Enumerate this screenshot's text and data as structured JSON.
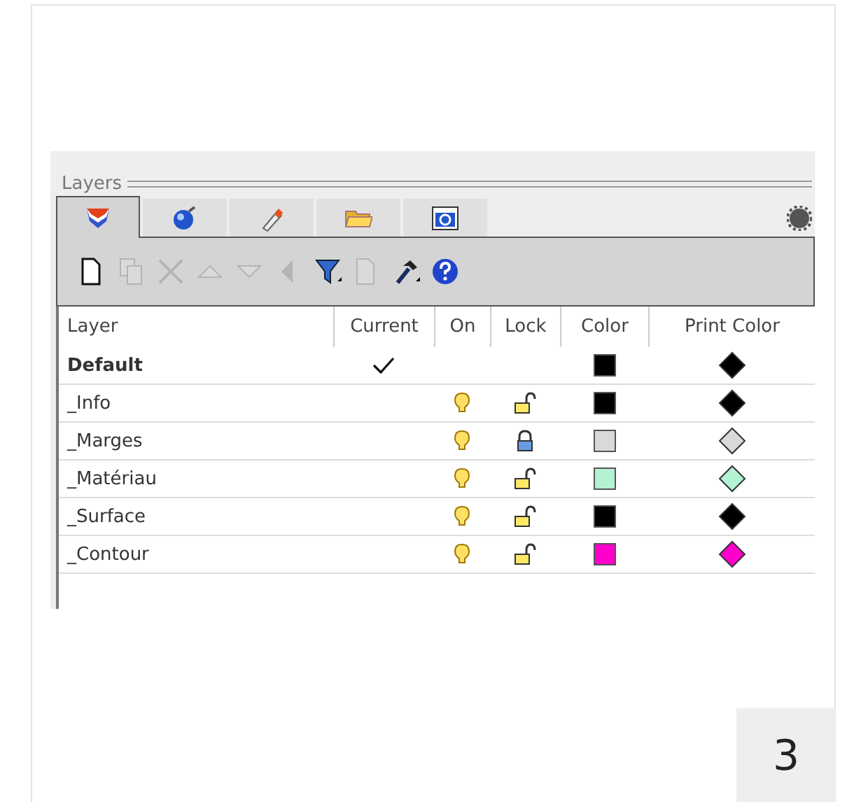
{
  "panel": {
    "title": "Layers"
  },
  "tabs": [
    {
      "kind": "layers",
      "selected": true
    },
    {
      "kind": "sphere",
      "selected": false
    },
    {
      "kind": "brush",
      "selected": false
    },
    {
      "kind": "folder",
      "selected": false
    },
    {
      "kind": "help",
      "selected": false
    }
  ],
  "toolbar": [
    {
      "kind": "new",
      "disabled": false
    },
    {
      "kind": "copy",
      "disabled": true
    },
    {
      "kind": "delete",
      "disabled": true
    },
    {
      "kind": "up",
      "disabled": true
    },
    {
      "kind": "down",
      "disabled": true
    },
    {
      "kind": "left",
      "disabled": true
    },
    {
      "kind": "filter",
      "disabled": false
    },
    {
      "kind": "page",
      "disabled": true
    },
    {
      "kind": "tools",
      "disabled": false
    },
    {
      "kind": "help",
      "disabled": false
    }
  ],
  "table": {
    "columns": [
      "Layer",
      "Current",
      "On",
      "Lock",
      "Color",
      "Print Color"
    ],
    "rows": [
      {
        "name": "Default",
        "current": true,
        "color": "#000000",
        "print": {
          "color": "#000000"
        }
      },
      {
        "name": "_Info",
        "current": false,
        "on": true,
        "locked": false,
        "color": "#000000",
        "print": {
          "color": "#000000"
        }
      },
      {
        "name": "_Marges",
        "current": false,
        "on": true,
        "locked": true,
        "color": "#d9d9d9",
        "print": {
          "color": "#d9d9d9"
        }
      },
      {
        "name": "_Matériau",
        "current": false,
        "on": true,
        "locked": false,
        "color": "#b3f2d2",
        "print": {
          "color": "#b3f2d2"
        }
      },
      {
        "name": "_Surface",
        "current": false,
        "on": true,
        "locked": false,
        "color": "#000000",
        "print": {
          "color": "#000000"
        }
      },
      {
        "name": "_Contour",
        "current": false,
        "on": true,
        "locked": false,
        "color": "#ff00cc",
        "print": {
          "color": "#ff00cc"
        }
      }
    ]
  },
  "page_number": "3"
}
